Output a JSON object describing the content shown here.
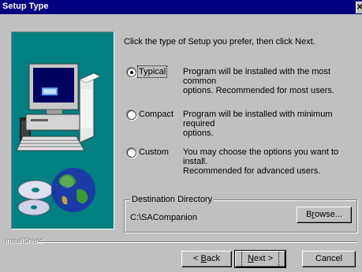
{
  "window": {
    "title": "Setup Type",
    "close_glyph": "✕"
  },
  "intro": "Click the type of Setup you prefer, then click Next.",
  "options": [
    {
      "label": "Typical",
      "desc_line1": "Program will be installed with the most common",
      "desc_line2": "options. Recommended for most users.",
      "selected": true
    },
    {
      "label": "Compact",
      "desc_line1": "Program will be installed with minimum required",
      "desc_line2": "options.",
      "selected": false
    },
    {
      "label": "Custom",
      "desc_line1": "You may choose the options you want to install.",
      "desc_line2": "Recommended for advanced users.",
      "selected": false
    }
  ],
  "destination": {
    "legend": "Destination Directory",
    "path": "C:\\SACompanion",
    "browse_pre": "B",
    "browse_accel": "r",
    "browse_post": "owse..."
  },
  "brand": "InstallShield",
  "buttons": {
    "back_pre": "< ",
    "back_accel": "B",
    "back_post": "ack",
    "next_accel": "N",
    "next_post": "ext >",
    "cancel": "Cancel"
  },
  "icons": {
    "art": "computer-cd-globe-illustration"
  }
}
